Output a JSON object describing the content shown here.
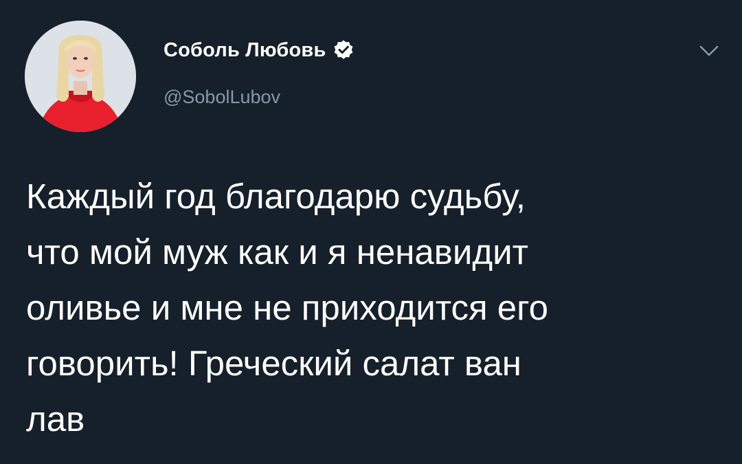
{
  "author": {
    "display_name": "Соболь Любовь",
    "handle": "@SobolLubov",
    "verified": true,
    "avatar_icon": "profile-photo"
  },
  "menu": {
    "icon": "chevron-down-icon"
  },
  "tweet": {
    "lines": [
      "Каждый год благодарю судьбу,",
      "что мой муж как и я ненавидит",
      "оливье и мне не приходится его",
      "говорить! Греческий салат ван",
      "лав"
    ]
  },
  "colors": {
    "background": "#15202b",
    "text_primary": "#ffffff",
    "text_secondary": "#8899a6"
  }
}
